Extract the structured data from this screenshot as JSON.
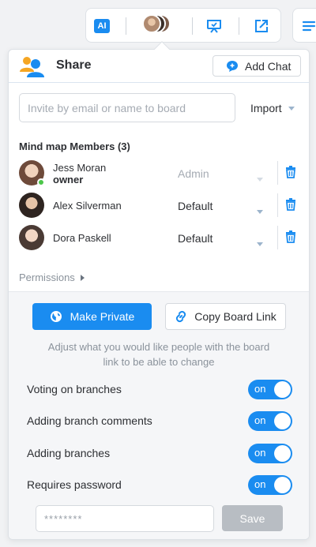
{
  "toolbar": {
    "ai_label": "AI",
    "icons": [
      "ai-icon",
      "collaborators-avatars",
      "presentation-icon",
      "export-icon",
      "menu-icon"
    ]
  },
  "header": {
    "title": "Share",
    "add_chat_label": "Add Chat"
  },
  "invite": {
    "placeholder": "Invite by email or name to board",
    "import_label": "Import"
  },
  "members": {
    "title": "Mind map Members (3)",
    "list": [
      {
        "name": "Jess Moran",
        "subtitle": "owner",
        "role": "Admin",
        "role_disabled": true,
        "online": true
      },
      {
        "name": "Alex Silverman",
        "subtitle": "",
        "role": "Default",
        "role_disabled": false,
        "online": false
      },
      {
        "name": "Dora Paskell",
        "subtitle": "",
        "role": "Default",
        "role_disabled": false,
        "online": false
      }
    ]
  },
  "permissions": {
    "label": "Permissions",
    "make_private_label": "Make Private",
    "copy_link_label": "Copy Board Link",
    "hint": "Adjust what you would like people with the board link to be able to change",
    "toggles": [
      {
        "label": "Voting on branches",
        "state": "on"
      },
      {
        "label": "Adding branch comments",
        "state": "on"
      },
      {
        "label": "Adding branches",
        "state": "on"
      },
      {
        "label": "Requires password",
        "state": "on"
      }
    ],
    "password_placeholder": "********",
    "save_label": "Save"
  },
  "colors": {
    "accent": "#1a8cf0",
    "online": "#4cc64a",
    "save_disabled": "#b8bdc3"
  }
}
